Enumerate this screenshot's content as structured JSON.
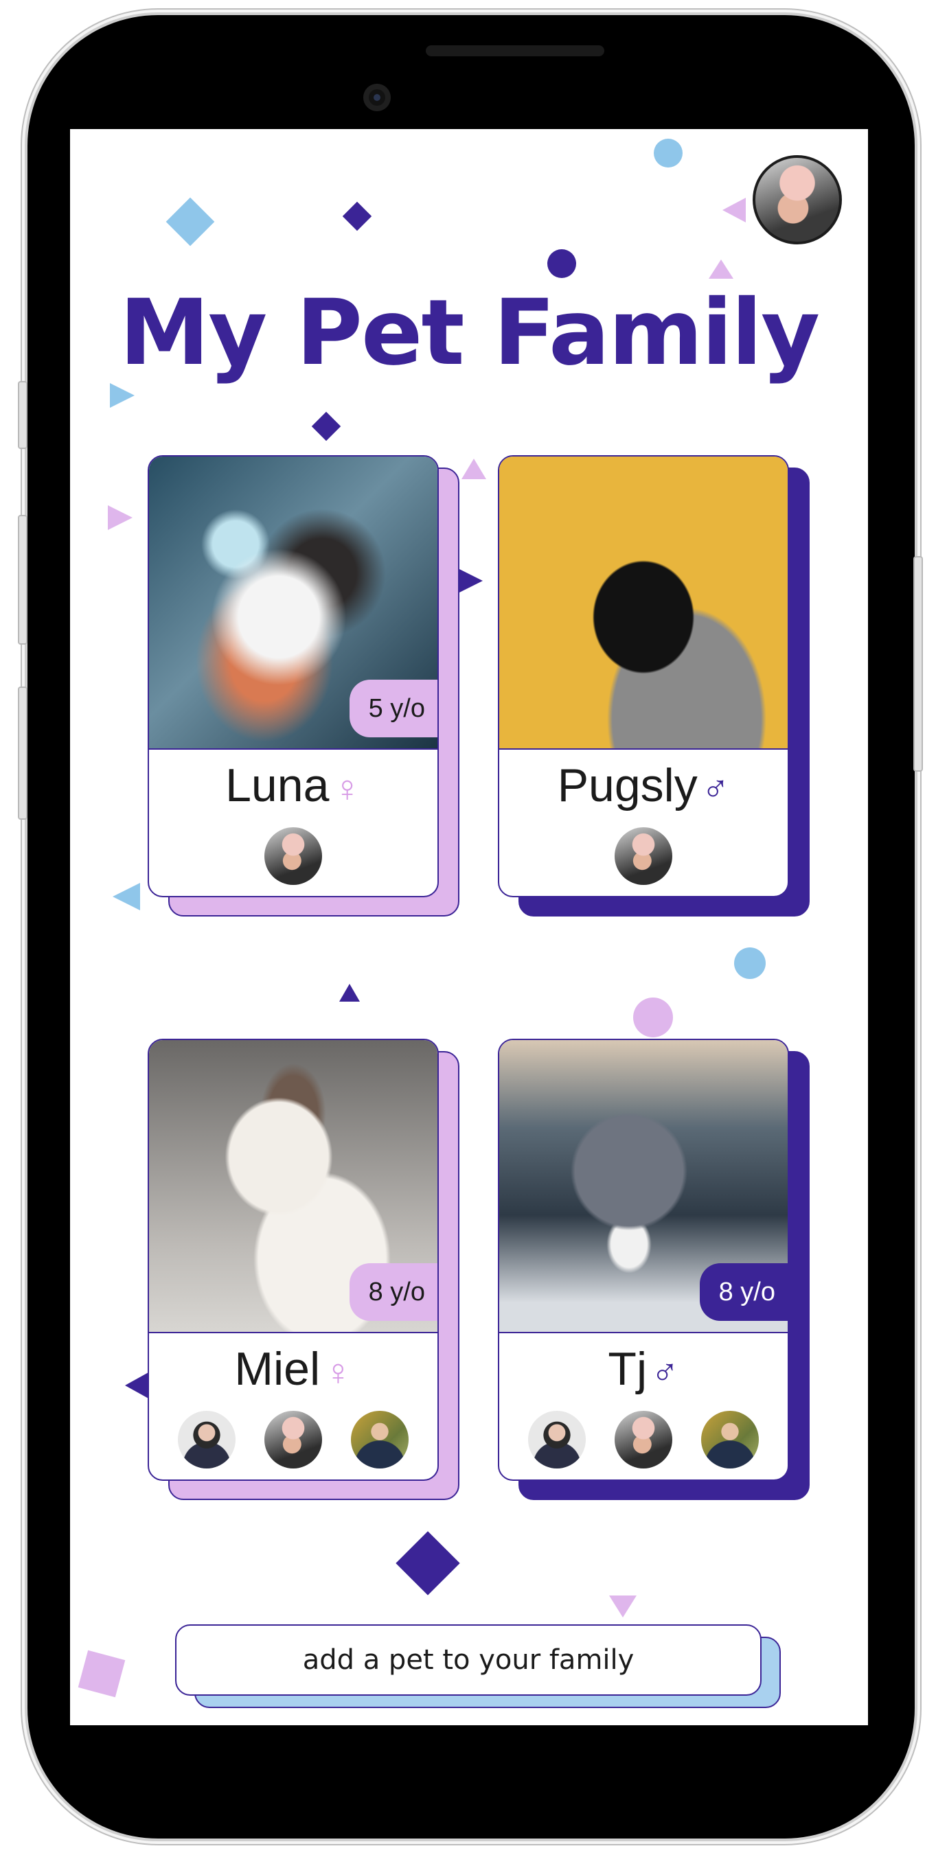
{
  "title": "My Pet Family",
  "add_button": "add a pet to your family",
  "colors": {
    "primary": "#3b2496",
    "pink": "#dfb6ec",
    "sky": "#a9d1ef"
  },
  "pets": [
    {
      "name": "Luna",
      "gender_symbol": "♀",
      "gender_color": "#d79be6",
      "age": "5 y/o",
      "age_style": "light",
      "owners": 1
    },
    {
      "name": "Pugsly",
      "gender_symbol": "♂",
      "gender_color": "#3b2496",
      "age": "",
      "age_style": "none",
      "owners": 1
    },
    {
      "name": "Miel",
      "gender_symbol": "♀",
      "gender_color": "#d79be6",
      "age": "8 y/o",
      "age_style": "light",
      "owners": 3
    },
    {
      "name": "Tj",
      "gender_symbol": "♂",
      "gender_color": "#3b2496",
      "age": "8 y/o",
      "age_style": "dark",
      "owners": 3
    }
  ]
}
